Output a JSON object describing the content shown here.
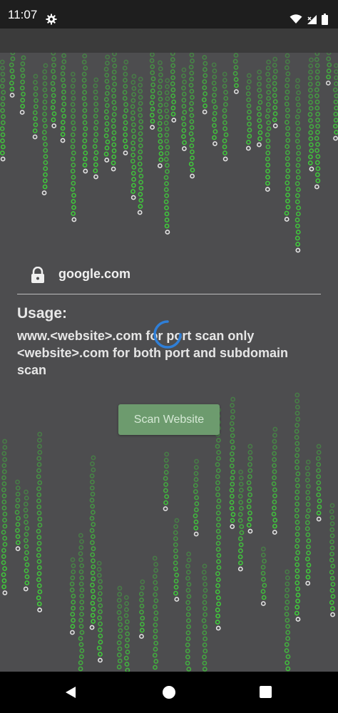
{
  "status_bar": {
    "time": "11:07",
    "icons": [
      "gear-icon",
      "wifi-icon",
      "signal-icon",
      "battery-icon"
    ]
  },
  "input": {
    "value": "google.com",
    "icon": "lock-icon"
  },
  "usage": {
    "title": "Usage:",
    "line1": "www.<website>.com for port scan only",
    "line2": "<website>.com for both port and subdomain",
    "line3": "scan"
  },
  "scan_button": {
    "label": "Scan Website"
  },
  "colors": {
    "background": "#4d4d4f",
    "matrix_green": "#3fd13a",
    "button": "#6d9b6e",
    "spinner": "#2f7fd8"
  },
  "nav": {
    "icons": [
      "back-icon",
      "home-icon",
      "recents-icon"
    ]
  }
}
